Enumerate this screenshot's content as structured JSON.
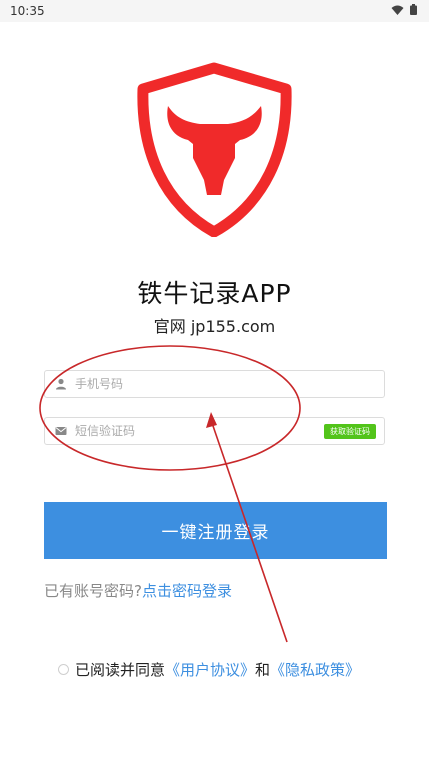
{
  "status": {
    "time": "10:35"
  },
  "brand": {
    "app_name": "铁牛记录APP",
    "site": "官网 jp155.com",
    "logo_color": "#f02a2a"
  },
  "form": {
    "phone_placeholder": "手机号码",
    "code_placeholder": "短信验证码",
    "get_code_label": "获取验证码",
    "login_label": "一键注册登录"
  },
  "password_login": {
    "prompt": "已有账号密码?",
    "link": "点击密码登录"
  },
  "agreement": {
    "text": "已阅读并同意",
    "user_agreement": "《用户协议》",
    "and": "和",
    "privacy_policy": "《隐私政策》"
  },
  "colors": {
    "accent": "#3d8fe0",
    "green": "#52c41a",
    "annotation": "#c8282a"
  }
}
